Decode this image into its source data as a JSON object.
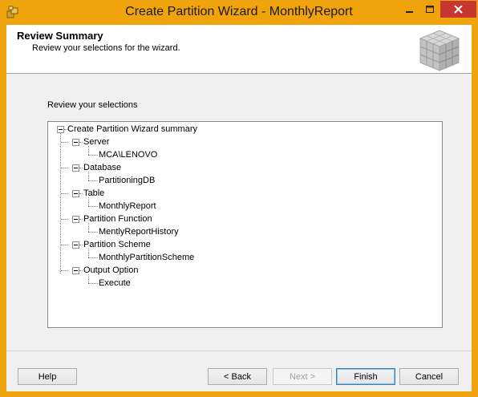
{
  "window": {
    "title": "Create Partition Wizard - MonthlyReport"
  },
  "header": {
    "title": "Review Summary",
    "subtitle": "Review your selections for the wizard."
  },
  "main": {
    "review_label": "Review your selections",
    "tree": {
      "root": "Create Partition Wizard summary",
      "groups": [
        {
          "label": "Server",
          "value": "MCA\\LENOVO"
        },
        {
          "label": "Database",
          "value": "PartitioningDB"
        },
        {
          "label": "Table",
          "value": "MonthlyReport"
        },
        {
          "label": "Partition Function",
          "value": "MentlyReportHistory"
        },
        {
          "label": "Partition Scheme",
          "value": "MonthlyPartitionScheme"
        },
        {
          "label": "Output Option",
          "value": "Execute"
        }
      ]
    }
  },
  "footer": {
    "help_label": "Help",
    "back_label": "< Back",
    "next_label": "Next >",
    "finish_label": "Finish",
    "cancel_label": "Cancel"
  },
  "colors": {
    "titlebar": "#f0a30a",
    "close_button": "#c7372f"
  }
}
